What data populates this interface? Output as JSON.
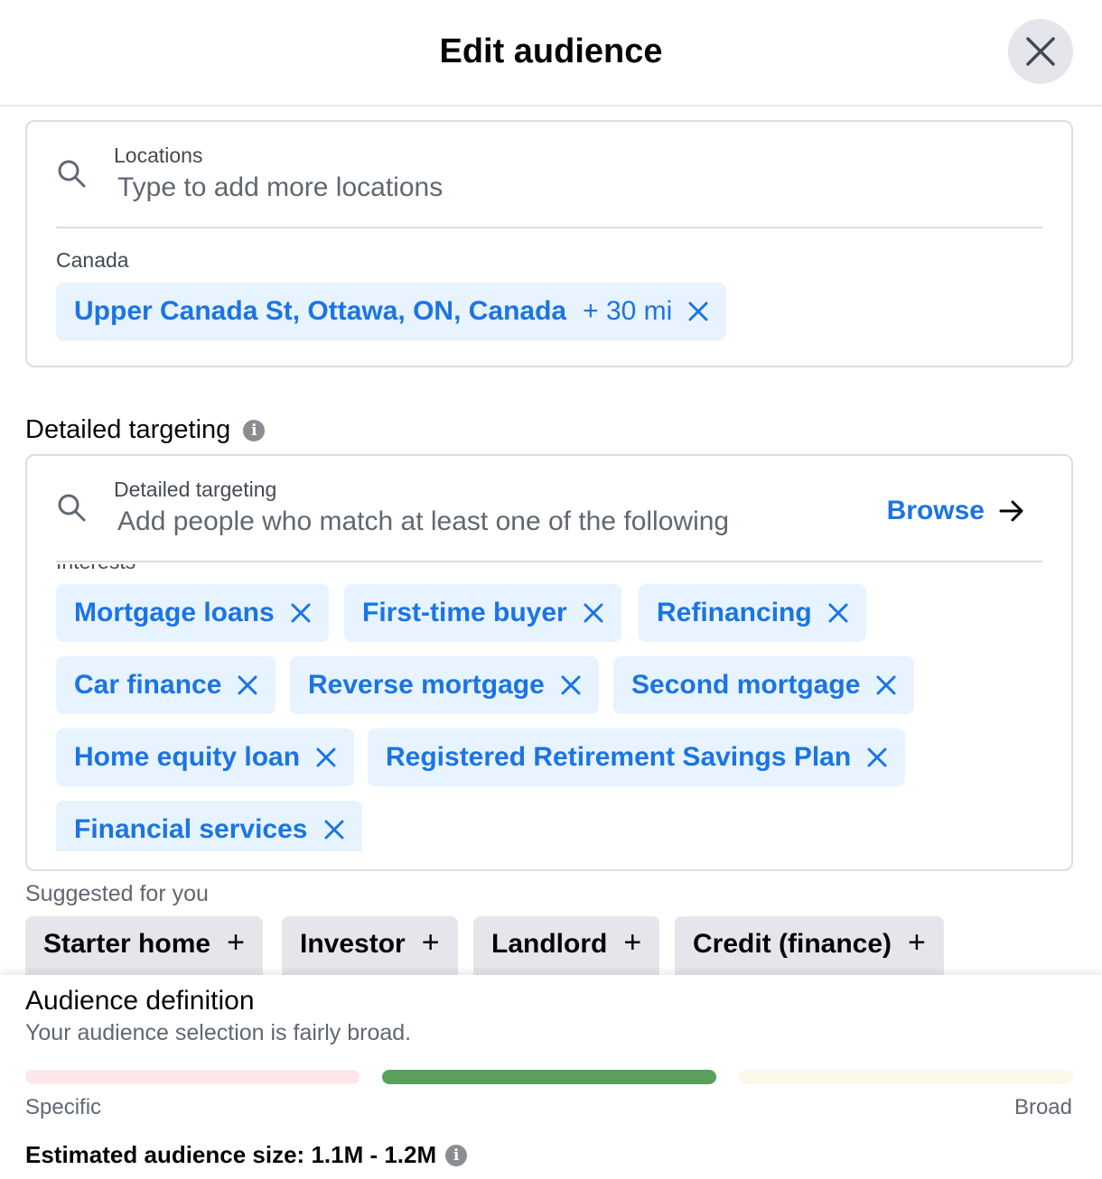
{
  "header": {
    "title": "Edit audience"
  },
  "locations": {
    "label": "Locations",
    "placeholder": "Type to add more locations",
    "group_label": "Canada",
    "selected": {
      "name": "Upper Canada St, Ottawa, ON, Canada",
      "radius": "+ 30 mi"
    }
  },
  "detailed_targeting": {
    "title": "Detailed targeting",
    "search_label": "Detailed targeting",
    "placeholder": "Add people who match at least one of the following",
    "browse_label": "Browse",
    "group_label": "Interests",
    "interests": [
      "Mortgage loans",
      "First-time buyer",
      "Refinancing",
      "Car finance",
      "Reverse mortgage",
      "Second mortgage",
      "Home equity loan",
      "Registered Retirement Savings Plan",
      "Financial services"
    ]
  },
  "suggested": {
    "title": "Suggested for you",
    "items": [
      "Starter home",
      "Investor",
      "Landlord",
      "Credit (finance)"
    ]
  },
  "audience_definition": {
    "title": "Audience definition",
    "description": "Your audience selection is fairly broad.",
    "specific_label": "Specific",
    "broad_label": "Broad",
    "level": "fairly broad",
    "colors": {
      "specific": "#fce8ea",
      "active": "#58a05c",
      "broad": "#fbf8ec"
    },
    "estimated_size": "Estimated audience size: 1.1M - 1.2M"
  },
  "colors": {
    "accent": "#1b74e4",
    "chip_bg": "#e7f3ff"
  }
}
